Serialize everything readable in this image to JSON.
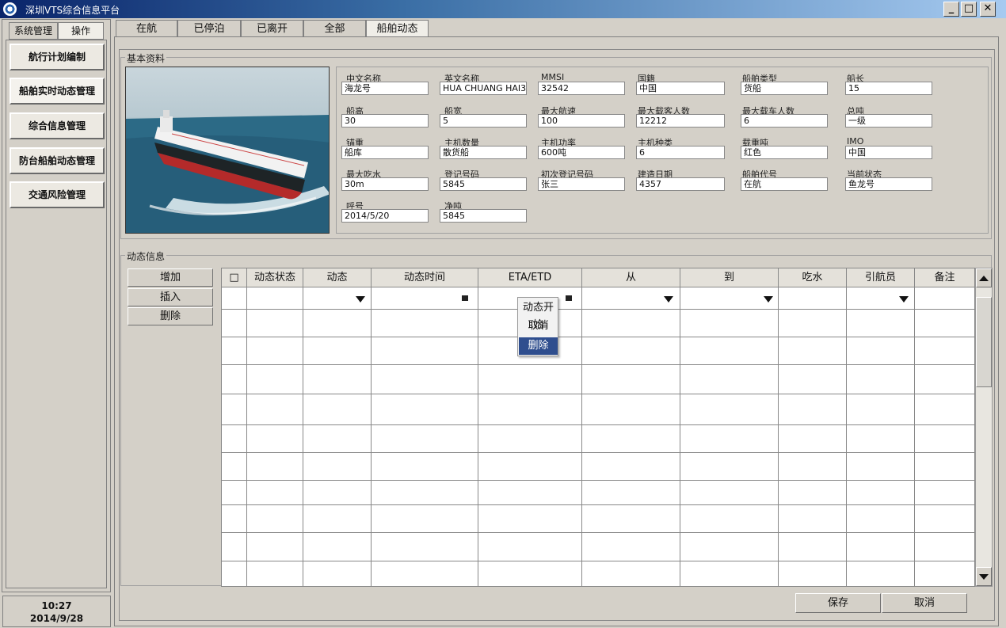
{
  "window": {
    "title": "深圳VTS综合信息平台"
  },
  "left_tabs": [
    "系统管理",
    "操作"
  ],
  "nav": [
    "航行计划编制",
    "船舶实时动态管理",
    "综合信息管理",
    "防台船舶动态管理",
    "交通风险管理"
  ],
  "clock": {
    "time": "10:27",
    "date": "2014/9/28"
  },
  "top_tabs": [
    "在航",
    "已停泊",
    "已离开",
    "全部",
    "船舶动态"
  ],
  "basic": {
    "title": "基本资料",
    "fields": [
      {
        "label": "中文名称",
        "value": "海龙号"
      },
      {
        "label": "英文名称",
        "value": "HUA CHUANG HAI3"
      },
      {
        "label": "MMSI",
        "value": "32542"
      },
      {
        "label": "国籍",
        "value": "中国"
      },
      {
        "label": "船舶类型",
        "value": "货船"
      },
      {
        "label": "船长",
        "value": "15"
      },
      {
        "label": "船高",
        "value": "30"
      },
      {
        "label": "船宽",
        "value": "5"
      },
      {
        "label": "最大航速",
        "value": "100"
      },
      {
        "label": "最大载客人数",
        "value": "12212"
      },
      {
        "label": "最大载车人数",
        "value": "6"
      },
      {
        "label": "总吨",
        "value": "一级"
      },
      {
        "label": "锚重",
        "value": "船库"
      },
      {
        "label": "主机数量",
        "value": "散货船"
      },
      {
        "label": "主机功率",
        "value": "600吨"
      },
      {
        "label": "主机种类",
        "value": "6"
      },
      {
        "label": "载重吨",
        "value": "红色"
      },
      {
        "label": "IMO",
        "value": "中国"
      },
      {
        "label": "最大吃水",
        "value": "30m"
      },
      {
        "label": "登记号码",
        "value": "5845"
      },
      {
        "label": "初次登记号码",
        "value": "张三"
      },
      {
        "label": "建造日期",
        "value": "4357"
      },
      {
        "label": "船舶代号",
        "value": "在航"
      },
      {
        "label": "当前状态",
        "value": "鱼龙号"
      },
      {
        "label": "呼号",
        "value": "2014/5/20"
      },
      {
        "label": "净吨",
        "value": "5845"
      }
    ]
  },
  "dynamic": {
    "title": "动态信息",
    "actions": [
      "增加",
      "插入",
      "删除"
    ],
    "columns": [
      "□",
      "动态状态",
      "动态",
      "动态时间",
      "ETA/ETD",
      "从",
      "到",
      "吃水",
      "引航员",
      "备注"
    ],
    "context_menu": [
      "动态开始",
      "取消",
      "删除"
    ],
    "context_selected": "删除"
  },
  "footer": {
    "save": "保存",
    "cancel": "取消"
  }
}
